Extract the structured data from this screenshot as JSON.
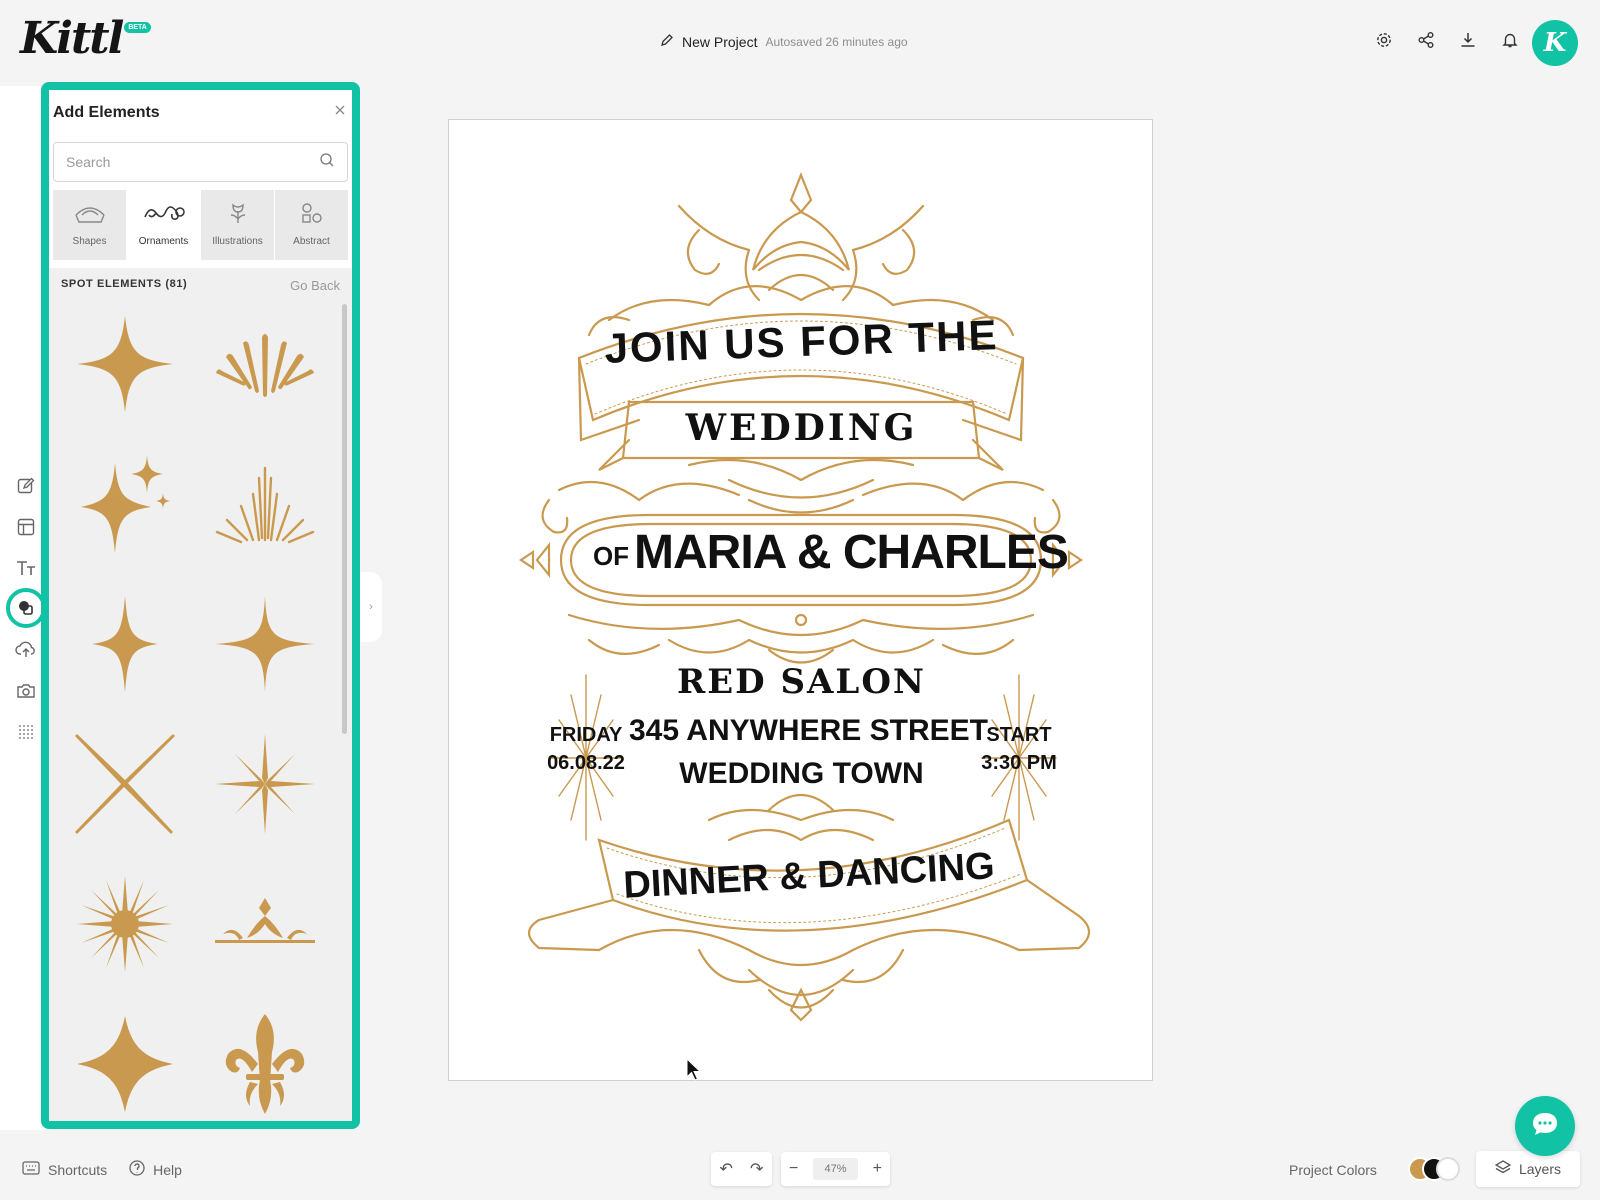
{
  "header": {
    "logo": "Kittl",
    "beta_badge": "BETA",
    "project_name": "New Project",
    "autosave": "Autosaved 26 minutes ago",
    "avatar_letter": "K",
    "icons": [
      "gear-icon",
      "share-icon",
      "download-icon",
      "bell-icon"
    ]
  },
  "left_rail": {
    "items": [
      "edit-icon",
      "templates-icon",
      "text-icon",
      "elements-icon",
      "upload-icon",
      "camera-icon",
      "grid-dots-icon"
    ],
    "active": "elements-icon"
  },
  "panel": {
    "title": "Add Elements",
    "search_placeholder": "Search",
    "categories": [
      {
        "label": "Shapes"
      },
      {
        "label": "Ornaments"
      },
      {
        "label": "Illustrations"
      },
      {
        "label": "Abstract"
      }
    ],
    "active_category": "Ornaments",
    "section_title": "SPOT ELEMENTS (81)",
    "go_back": "Go Back",
    "elements": [
      "four-point-star",
      "sunburst-arc",
      "sparkle-cluster",
      "fan-burst",
      "slim-star",
      "crossed-star",
      "x-cross",
      "six-point-star",
      "sun-burst",
      "crown-ornament",
      "diamond-star",
      "fleur-de-lis"
    ]
  },
  "canvas": {
    "text": {
      "line1": "JOIN US FOR THE",
      "line2": "WEDDING",
      "of": "OF",
      "names": "MARIA & CHARLES",
      "venue": "RED SALON",
      "street": "345 ANYWHERE STREET",
      "town": "WEDDING TOWN",
      "day": "FRIDAY",
      "date": "06.08.22",
      "start": "START",
      "time": "3:30 PM",
      "footer": "DINNER & DANCING"
    },
    "accent_color": "#c9994f"
  },
  "bottom": {
    "shortcuts": "Shortcuts",
    "help": "Help",
    "zoom": "47%",
    "project_colors": "Project Colors",
    "layers": "Layers",
    "swatch_colors": [
      "#c9994f",
      "#111111",
      "#ffffff"
    ]
  },
  "colors": {
    "brand": "#12c2a4",
    "gold": "#c9994f"
  }
}
